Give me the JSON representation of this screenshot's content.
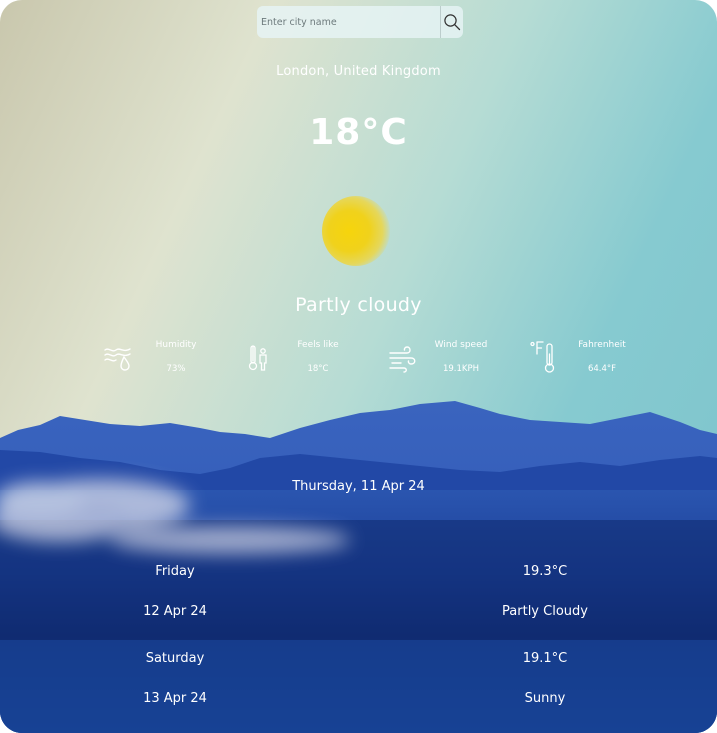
{
  "search": {
    "placeholder": "Enter city name"
  },
  "location": "London, United Kingdom",
  "current": {
    "temperature": "18°C",
    "condition": "Partly cloudy"
  },
  "stats": [
    {
      "icon": "humidity-icon",
      "label": "Humidity",
      "value": "73%"
    },
    {
      "icon": "feels-like-icon",
      "label": "Feels like",
      "value": "18°C"
    },
    {
      "icon": "wind-icon",
      "label": "Wind speed",
      "value": "19.1KPH"
    },
    {
      "icon": "thermometer-icon",
      "label": "Fahrenheit",
      "value": "64.4°F"
    }
  ],
  "today": "Thursday, 11 Apr 24",
  "forecast": [
    {
      "day": "Friday",
      "date": "12 Apr 24",
      "temp": "19.3°C",
      "condition": "Partly Cloudy"
    },
    {
      "day": "Saturday",
      "date": "13 Apr 24",
      "temp": "19.1°C",
      "condition": "Sunny"
    }
  ]
}
